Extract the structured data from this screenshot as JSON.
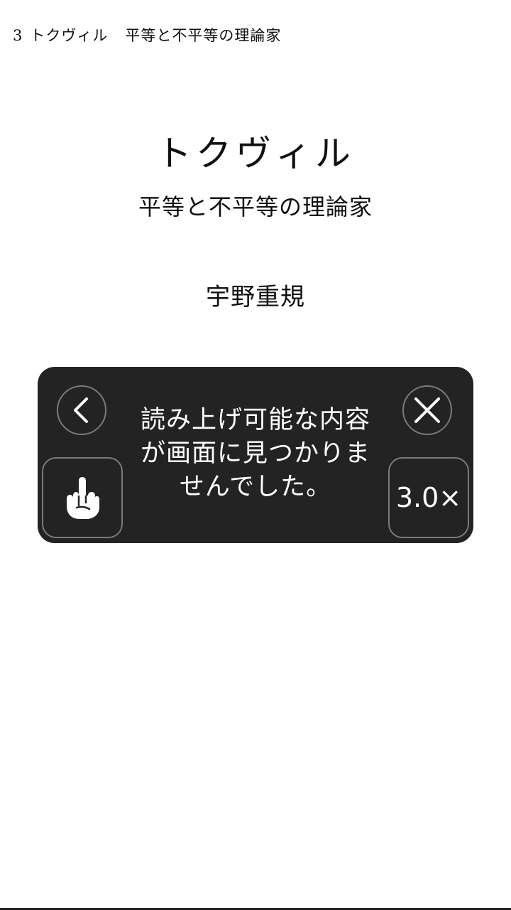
{
  "header": {
    "chapter_number": "3",
    "chapter_name": "トクヴィル",
    "chapter_subtitle": "平等と不平等の理論家"
  },
  "page": {
    "title": "トクヴィル",
    "subtitle": "平等と不平等の理論家",
    "author": "宇野重規"
  },
  "speech_controller": {
    "message": "読み上げ可能な内容が画面に見つかりませんでした。",
    "speed_label": "3.0×",
    "back_icon": "chevron-left-icon",
    "close_icon": "close-x-icon",
    "touch_icon": "pointing-hand-icon"
  },
  "colors": {
    "panel_background": "#232323",
    "panel_border": "#7a7a7a",
    "page_background": "#ffffff"
  }
}
